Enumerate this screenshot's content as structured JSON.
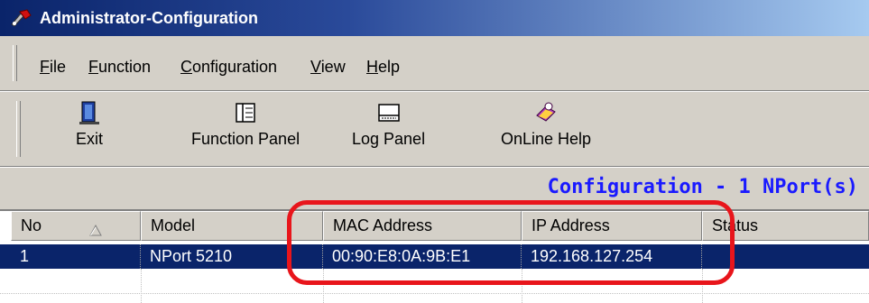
{
  "window": {
    "title": "Administrator-Configuration"
  },
  "menu": [
    {
      "label_u": "F",
      "label_rest": "ile"
    },
    {
      "label_u": "F",
      "label_rest": "unction"
    },
    {
      "label_u": "C",
      "label_rest": "onfiguration"
    },
    {
      "label_u": "V",
      "label_rest": "iew"
    },
    {
      "label_u": "H",
      "label_rest": "elp"
    }
  ],
  "toolbar": {
    "exit_label": "Exit",
    "function_panel_label": "Function Panel",
    "log_panel_label": "Log Panel",
    "online_help_label": "OnLine Help"
  },
  "status": {
    "configuration_text": "Configuration - 1 NPort(s)"
  },
  "table": {
    "columns": [
      "No",
      "Model",
      "MAC Address",
      "IP Address",
      "Status"
    ],
    "rows": [
      {
        "no": "1",
        "model": "NPort 5210",
        "mac": "00:90:E8:0A:9B:E1",
        "ip": "192.168.127.254",
        "status": ""
      }
    ]
  },
  "colors": {
    "selection": "#0a246a",
    "highlight_outline": "#e8151b",
    "status_text": "#1a1aff"
  }
}
